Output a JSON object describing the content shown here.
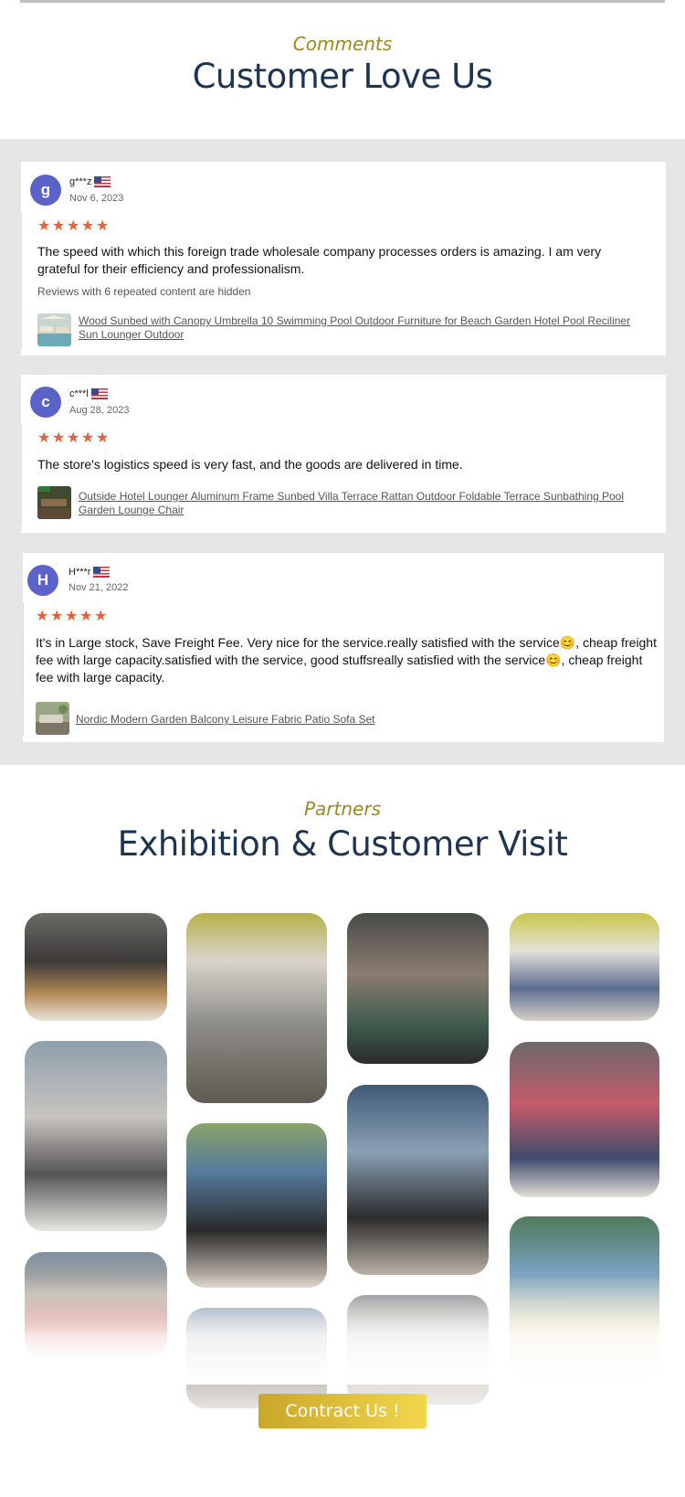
{
  "comments_section": {
    "subtitle": "Comments",
    "title": "Customer Love Us"
  },
  "reviews": [
    {
      "initial": "g",
      "username": "g***z",
      "date": "Nov 6, 2023",
      "rating": 5,
      "text": "The speed with which this foreign trade wholesale company processes orders is amazing. I am very grateful for their efficiency and professionalism.",
      "hidden_note": "Reviews with 6 repeated content are hidden",
      "product": "Wood Sunbed with Canopy Umbrella 10 Swimming Pool Outdoor Furniture for Beach Garden Hotel Pool Reciliner Sun Lounger Outdoor"
    },
    {
      "initial": "c",
      "username": "c***l",
      "date": "Aug 28, 2023",
      "rating": 5,
      "text": "The store's logistics speed is very fast, and the goods are delivered in time.",
      "product": "Outside Hotel Lounger Aluminum Frame Sunbed Villa Terrace Rattan Outdoor Foldable Terrace Sunbathing Pool Garden Lounge Chair"
    },
    {
      "initial": "H",
      "username": "H***r",
      "date": "Nov 21, 2022",
      "rating": 5,
      "text": "It's in Large stock, Save Freight Fee. Very nice for the service.really satisfied with the service😊, cheap freight fee with large capacity.satisfied with the service, good stuffsreally satisfied with the service😊, cheap freight fee with large capacity.",
      "product": "Nordic Modern Garden Balcony Leisure Fabric Patio Sofa Set"
    }
  ],
  "partners_section": {
    "subtitle": "Partners",
    "title": "Exhibition & Customer Visit"
  },
  "photos": [
    {
      "name": "photo-meeting-sofa",
      "icon": "photo-icon"
    },
    {
      "name": "photo-catalog-review",
      "icon": "photo-icon"
    },
    {
      "name": "photo-selfie",
      "icon": "photo-icon"
    },
    {
      "name": "photo-booth-chat",
      "icon": "photo-icon"
    },
    {
      "name": "photo-brochure-table",
      "icon": "photo-icon"
    },
    {
      "name": "photo-visitor-sofa",
      "icon": "photo-icon"
    },
    {
      "name": "photo-thumbs-up",
      "icon": "photo-icon"
    },
    {
      "name": "photo-booth-group",
      "icon": "photo-icon"
    },
    {
      "name": "photo-group-red-sofa",
      "icon": "photo-icon"
    },
    {
      "name": "photo-group-booth",
      "icon": "photo-icon"
    },
    {
      "name": "photo-partial-1",
      "icon": "photo-icon"
    },
    {
      "name": "photo-partial-2",
      "icon": "photo-icon"
    }
  ],
  "cta": {
    "label": "Contract Us !"
  },
  "colors": {
    "accent_gold": "#9b8a1f",
    "title_navy": "#1d3553",
    "star": "#e8613a",
    "avatar": "#5b63c9",
    "band": "#e6e6e6"
  }
}
